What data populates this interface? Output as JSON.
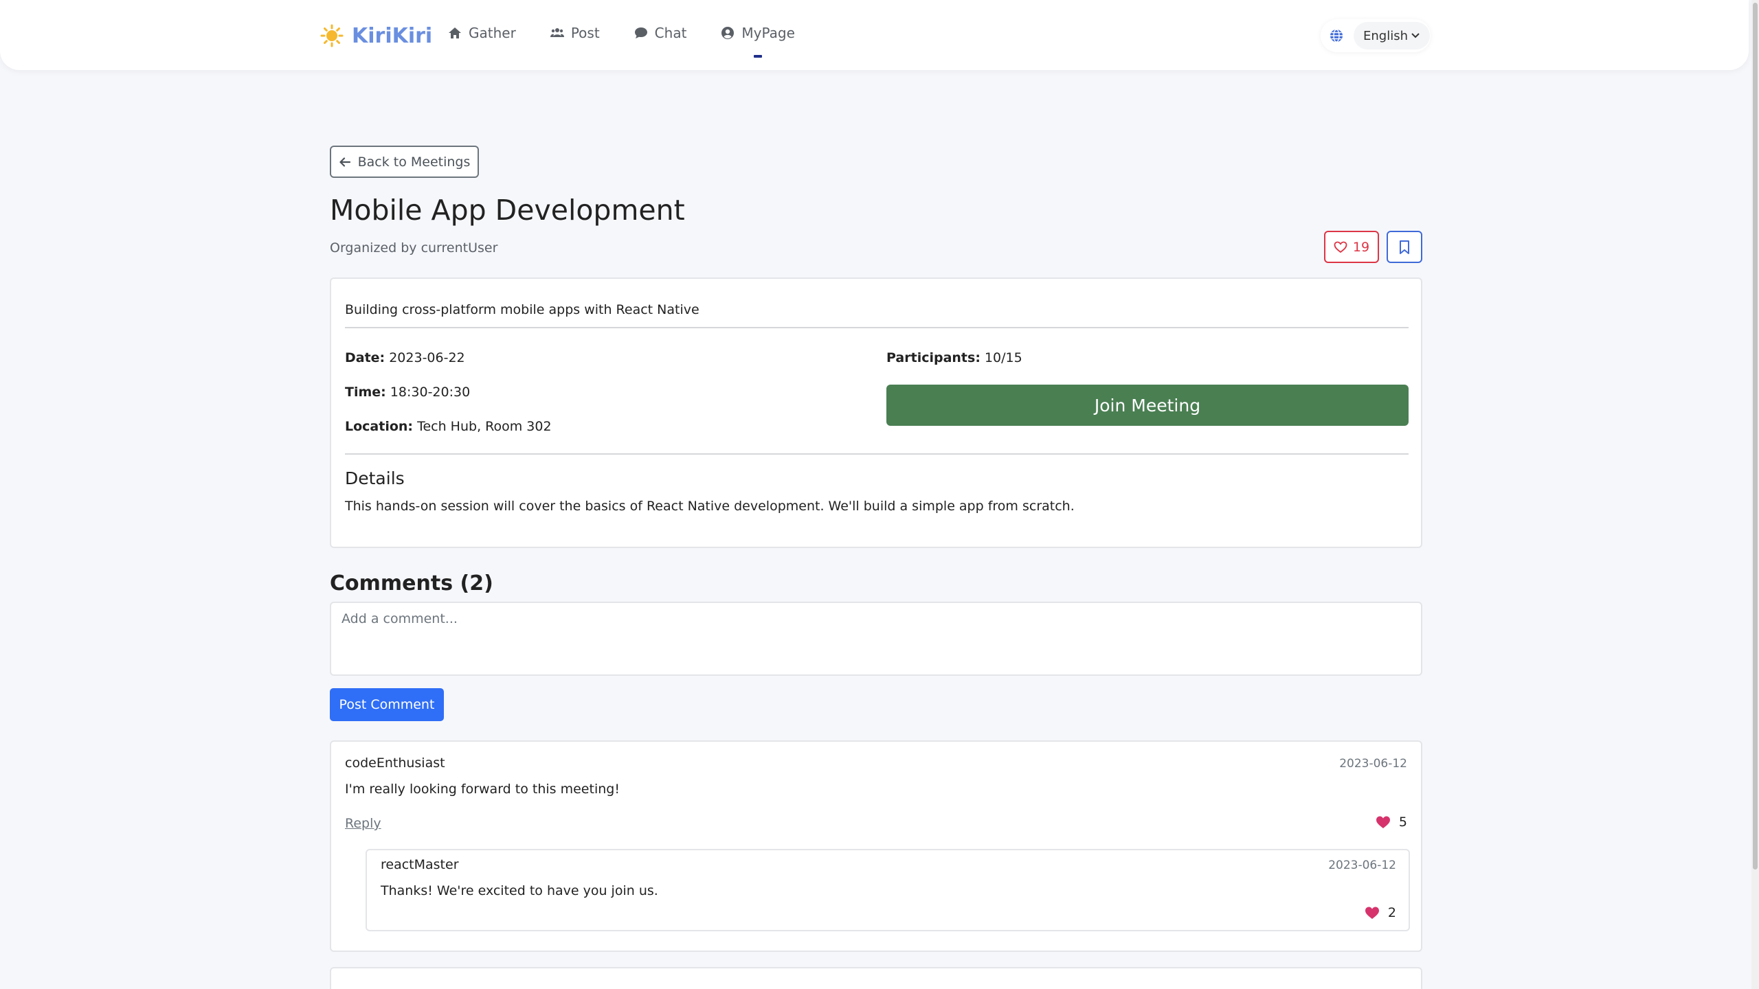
{
  "brand": {
    "name": "KiriKiri"
  },
  "nav": {
    "items": [
      {
        "label": "Gather",
        "icon": "home-icon"
      },
      {
        "label": "Post",
        "icon": "users-icon"
      },
      {
        "label": "Chat",
        "icon": "chat-bubble-icon"
      },
      {
        "label": "MyPage",
        "icon": "user-circle-icon"
      }
    ]
  },
  "language": {
    "selected": "English"
  },
  "meeting": {
    "back_label": "Back to Meetings",
    "title": "Mobile App Development",
    "organizer": "Organized by currentUser",
    "likes": "19",
    "description": "Building cross-platform mobile apps with React Native",
    "date_label": "Date:",
    "date": "2023-06-22",
    "time_label": "Time:",
    "time": "18:30-20:30",
    "location_label": "Location:",
    "location": "Tech Hub, Room 302",
    "participants_label": "Participants:",
    "participants": "10/15",
    "join_label": "Join Meeting",
    "details_heading": "Details",
    "details_text": "This hands-on session will cover the basics of React Native development. We'll build a simple app from scratch."
  },
  "comments": {
    "heading": "Comments (2)",
    "placeholder": "Add a comment...",
    "post_label": "Post Comment",
    "items": [
      {
        "author": "codeEnthusiast",
        "date": "2023-06-12",
        "text": "I'm really looking forward to this meeting!",
        "reply_label": "Reply",
        "likes": "5",
        "replies": [
          {
            "author": "reactMaster",
            "date": "2023-06-12",
            "text": "Thanks! We're excited to have you join us.",
            "likes": "2"
          }
        ]
      }
    ]
  },
  "colors": {
    "brand": "#6a8fe0",
    "join": "#4a7f52",
    "post": "#2f6ef6",
    "like": "#dc3545",
    "heart_fill": "#d6336c"
  }
}
